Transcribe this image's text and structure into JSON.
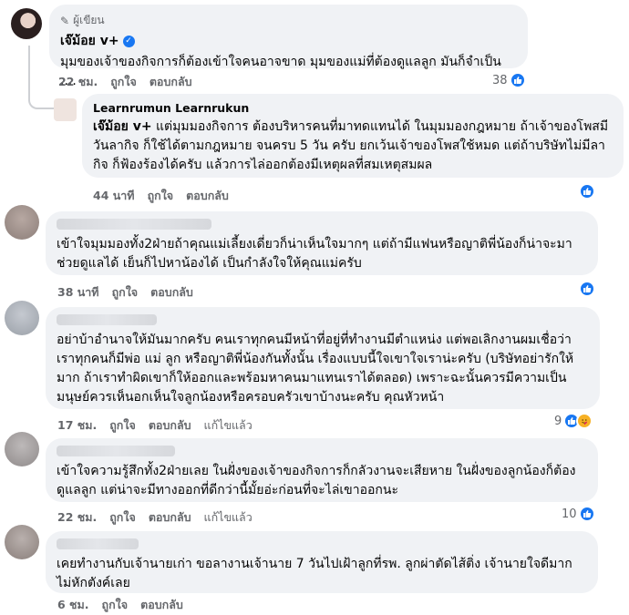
{
  "colors": {
    "bubble": "#f0f2f5",
    "accent": "#1877f2",
    "meta": "#65676b"
  },
  "comments": [
    {
      "badge": "ผู้เขียน",
      "name": "เจ๊ม้อย v+",
      "verified": true,
      "text": "มุมของเจ้าของกิจการก็ต้องเข้าใจคนอาจขาด มุมของแม่ที่ต้องดูแลลูก มันก็จำเป็น ....",
      "time": "22 ชม.",
      "like": "ถูกใจ",
      "reply": "ตอบกลับ",
      "reaction_count": "38"
    },
    {
      "name": "Learnrumun Learnrukun",
      "mention": "เจ๊ม้อย v+",
      "text": " แต่มุมมองกิจการ ต้องบริหารคนที่มาทดแทนได้ ในมุมมองกฎหมาย ถ้าเจ้าของโพสมีวันลากิจ ก็ใช้ได้ตามกฎหมาย จนครบ 5 วัน ครับ ยกเว้นเจ้าของโพสใช้หมด แต่ถ้าบริษัทไม่มีลากิจ ก็ฟ้องร้องได้ครับ แล้วการไล่ออกต้องมีเหตุผลที่สมเหตุสมผล",
      "time": "44 นาที",
      "like": "ถูกใจ",
      "reply": "ตอบกลับ"
    },
    {
      "text": "เข้าใจมุมมองทั้ง2ฝ่ายถ้าคุณแม่เลี้ยงเดี่ยวก็น่าเห็นใจมากๆ แต่ถ้ามีแฟนหรือญาติพี่น้องก็น่าจะมาช่วยดูแลได้ เย็นก็ไปหาน้องได้ เป็นกำลังใจให้คุณแม่ครับ",
      "time": "38 นาที",
      "like": "ถูกใจ",
      "reply": "ตอบกลับ"
    },
    {
      "text": "อย่าบ้าอำนาจให้มันมากครับ คนเราทุกคนมีหน้าที่อยู่ที่ทำงานมีตำแหน่ง แต่พอเลิกงานผมเชื่อว่าเราทุกคนก็มีพ่อ แม่ ลูก หรือญาติพี่น้องกันทั้งนั้น เรื่องแบบนี้ใจเขาใจเราน่ะครับ (บริษัทอย่ารักให้มาก ถ้าเราทำผิดเขาก็ให้ออกและพร้อมหาคนมาแทนเราได้ตลอด) เพราะฉะนั้นควรมีความเป็นมนุษย์ควรเห็นอกเห็นใจลูกน้องหรือครอบครัวเขาบ้างนะครับ คุณหัวหน้า",
      "time": "17 ชม.",
      "like": "ถูกใจ",
      "reply": "ตอบกลับ",
      "edited": "แก้ไขแล้ว",
      "reaction_count": "9"
    },
    {
      "text": "เข้าใจความรู้สึกทั้ง2ฝ่ายเลย ในฝั่งของเจ้าของกิจการก็กลัวงานจะเสียหาย ในฝั่งของลูกน้องก็ต้องดูแลลูก แต่น่าจะมีทางออกที่ดีกว่านี้มั้ยอ่ะก่อนที่จะไล่เขาออกนะ",
      "time": "22 ชม.",
      "like": "ถูกใจ",
      "reply": "ตอบกลับ",
      "edited": "แก้ไขแล้ว",
      "reaction_count": "10"
    },
    {
      "text": "เคยทำงานกับเจ้านายเก่า ขอลางานเจ้านาย 7 วันไปเฝ้าลูกที่รพ. ลูกผ่าตัดไส้ติ่ง เจ้านายใจดีมาก ไม่หักตังค์เลย",
      "time": "6 ชม.",
      "like": "ถูกใจ",
      "reply": "ตอบกลับ"
    }
  ]
}
